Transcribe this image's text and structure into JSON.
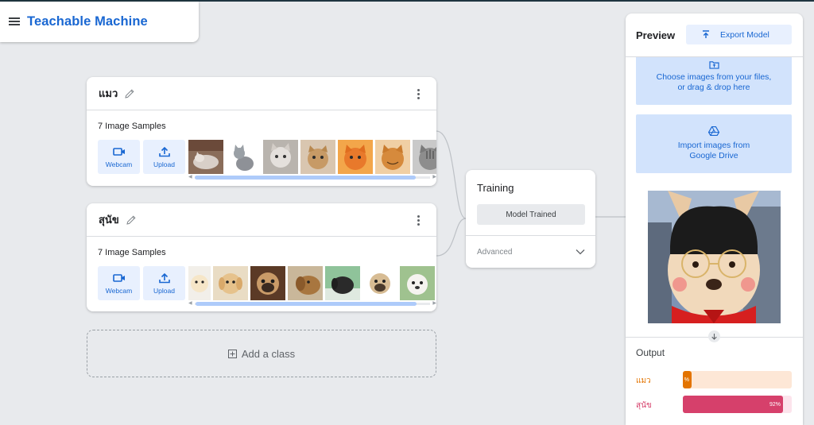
{
  "app": {
    "title": "Teachable Machine"
  },
  "classes": [
    {
      "name": "แมว",
      "samples_label": "7 Image Samples",
      "webcam_label": "Webcam",
      "upload_label": "Upload",
      "scroll_position": 0.0
    },
    {
      "name": "สุนัข",
      "samples_label": "7 Image Samples",
      "webcam_label": "Webcam",
      "upload_label": "Upload",
      "scroll_position": 0.08
    }
  ],
  "add_class": {
    "label": "Add a class"
  },
  "training": {
    "title": "Training",
    "button_label": "Model Trained",
    "advanced_label": "Advanced"
  },
  "preview": {
    "title": "Preview",
    "export_label": "Export Model",
    "choose_files_line1": "Choose images from your files,",
    "choose_files_line2": "or drag & drop here",
    "drive_line1": "Import images from",
    "drive_line2": "Google Drive"
  },
  "output": {
    "title": "Output",
    "rows": [
      {
        "label": "แมว",
        "percent": 8,
        "percent_text": "%",
        "color": "#e37400",
        "track": "#fde7d6"
      },
      {
        "label": "สุนัข",
        "percent": 92,
        "percent_text": "92%",
        "color": "#d6406b",
        "track": "#fce4ec"
      }
    ]
  },
  "colors": {
    "brand": "#1967d2",
    "background": "#e8eaed",
    "button_bg": "#e8f0fe",
    "drop_bg": "#d2e3fc"
  }
}
